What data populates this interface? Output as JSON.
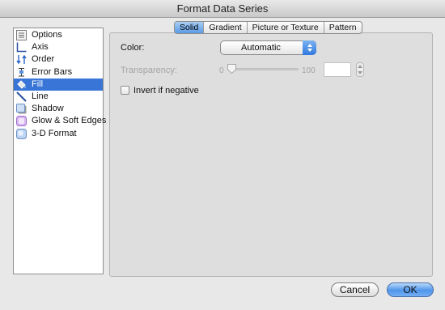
{
  "window": {
    "title": "Format Data Series"
  },
  "sidebar": {
    "items": [
      {
        "label": "Options",
        "icon": "options-icon",
        "selected": false
      },
      {
        "label": "Axis",
        "icon": "axis-icon",
        "selected": false
      },
      {
        "label": "Order",
        "icon": "order-icon",
        "selected": false
      },
      {
        "label": "Error Bars",
        "icon": "error-bars-icon",
        "selected": false
      },
      {
        "label": "Fill",
        "icon": "fill-bucket-icon",
        "selected": true
      },
      {
        "label": "Line",
        "icon": "line-icon",
        "selected": false
      },
      {
        "label": "Shadow",
        "icon": "shadow-icon",
        "selected": false
      },
      {
        "label": "Glow & Soft Edges",
        "icon": "glow-icon",
        "selected": false
      },
      {
        "label": "3-D Format",
        "icon": "3d-format-icon",
        "selected": false
      }
    ]
  },
  "tabs": [
    {
      "label": "Solid",
      "active": true
    },
    {
      "label": "Gradient",
      "active": false
    },
    {
      "label": "Picture or Texture",
      "active": false
    },
    {
      "label": "Pattern",
      "active": false
    }
  ],
  "fill": {
    "color_label": "Color:",
    "color_value": "Automatic",
    "transparency_label": "Transparency:",
    "slider_min": "0",
    "slider_max": "100",
    "transparency_value": "",
    "invert_label": "Invert if negative",
    "invert_checked": false
  },
  "buttons": {
    "cancel": "Cancel",
    "ok": "OK"
  },
  "colors": {
    "accent": "#3875d7",
    "selection": "#3875d7",
    "disabled_text": "#a3a3a3"
  }
}
